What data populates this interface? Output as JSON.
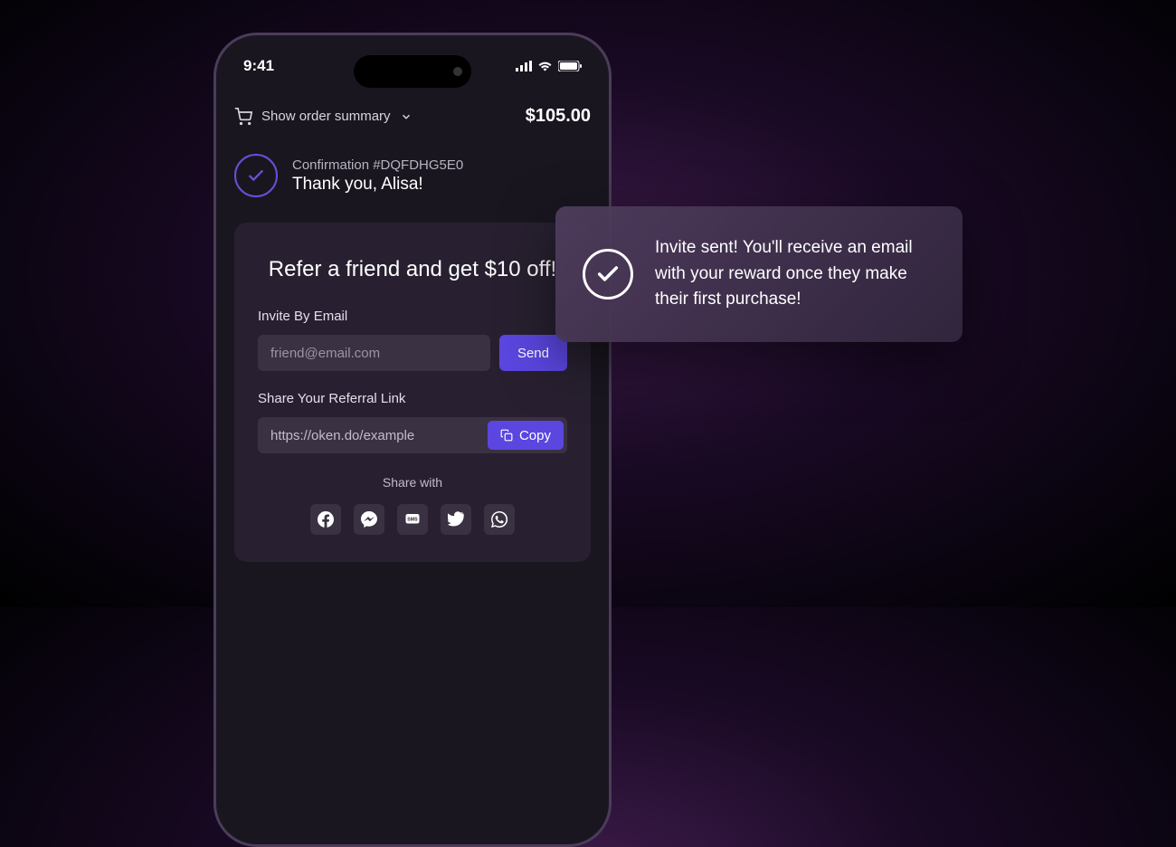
{
  "statusBar": {
    "time": "9:41"
  },
  "order": {
    "summaryLabel": "Show order summary",
    "total": "$105.00"
  },
  "confirmation": {
    "subtitle": "Confirmation #DQFDHG5E0",
    "title": "Thank you, Alisa!"
  },
  "referral": {
    "headline": "Refer a friend and get $10 off!",
    "emailLabel": "Invite By Email",
    "emailPlaceholder": "friend@email.com",
    "sendLabel": "Send",
    "linkLabel": "Share Your Referral Link",
    "linkValue": "https://oken.do/example",
    "copyLabel": "Copy",
    "shareLabel": "Share with"
  },
  "social": {
    "facebook": "Facebook",
    "messenger": "Messenger",
    "sms": "SMS",
    "twitter": "Twitter",
    "whatsapp": "WhatsApp"
  },
  "toast": {
    "message": "Invite sent! You'll receive an email with your reward once they make their first purchase!"
  },
  "colors": {
    "accent": "#5b46e0"
  }
}
